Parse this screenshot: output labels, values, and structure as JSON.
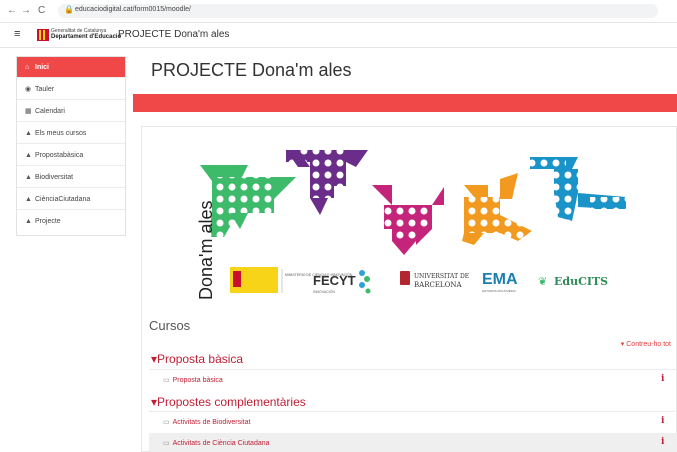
{
  "browser": {
    "back": "←",
    "forward": "→",
    "reload": "C",
    "lock": "🔒",
    "url": "educaciodigital.cat/form0015/moodle/"
  },
  "header": {
    "menu_icon": "≡",
    "org_line1": "Generalitat de Catalunya",
    "org_line2": "Departament d'Educació",
    "site_title": "PROJECTE Dona'm ales"
  },
  "sidebar": {
    "items": [
      {
        "label": "Inici",
        "icon": "home-icon",
        "glyph": "⌂",
        "active": true
      },
      {
        "label": "Tauler",
        "icon": "dashboard-icon",
        "glyph": "◉",
        "active": false
      },
      {
        "label": "Calendari",
        "icon": "calendar-icon",
        "glyph": "▦",
        "active": false
      },
      {
        "label": "Els meus cursos",
        "icon": "graduation-cap-icon",
        "glyph": "▲",
        "active": false
      },
      {
        "label": "Propostabàsica",
        "icon": "graduation-cap-icon",
        "glyph": "▲",
        "active": false
      },
      {
        "label": "Biodiversitat",
        "icon": "graduation-cap-icon",
        "glyph": "▲",
        "active": false
      },
      {
        "label": "CiènciaCiutadana",
        "icon": "graduation-cap-icon",
        "glyph": "▲",
        "active": false
      },
      {
        "label": "Projecte",
        "icon": "graduation-cap-icon",
        "glyph": "▲",
        "active": false
      }
    ]
  },
  "main": {
    "page_title": "PROJECTE Dona'm ales",
    "banner": {
      "vertical_title": "Dona'm ales",
      "logos": {
        "ministry": "MINISTERIO DE CIENCIA E INNOVACIÓN",
        "fecyt": "FECYT",
        "fecyt_sub": "INNOVACIÓN",
        "ub_line1": "UNIVERSITAT DE",
        "ub_line2": "BARCELONA",
        "ema": "EMA",
        "ema_sub": "ENTORNS MULTIMÈDIA",
        "edu": "EduCITS"
      },
      "colors": {
        "green": "#3dbb6a",
        "purple": "#6a2d8a",
        "magenta": "#c4247a",
        "orange": "#f29a1f",
        "blue": "#1a93c9"
      }
    },
    "courses_heading": "Cursos",
    "collapse_all": "Contreu-ho tot",
    "sections": [
      {
        "title": "Proposta bàsica",
        "activities": [
          {
            "label": "Proposta bàsica"
          }
        ]
      },
      {
        "title": "Propostes complementàries",
        "activities": [
          {
            "label": "Activitats de Biodiversitat"
          },
          {
            "label": "Activitats de Ciència Ciutadana"
          }
        ]
      }
    ],
    "info_icon": "i"
  },
  "theme": {
    "accent": "#f04848",
    "link": "#c01f36"
  }
}
